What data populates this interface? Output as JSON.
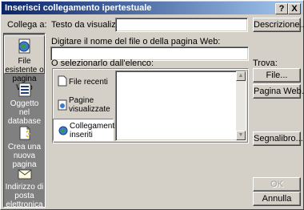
{
  "title": "Inserisci collegamento ipertestuale",
  "titlebar_buttons": {
    "help": "?",
    "close": "X"
  },
  "link_to": {
    "label": "Collega a:",
    "items": [
      {
        "label": "File esistente o pagina Web",
        "icon": "globe-page-icon",
        "selected": true
      },
      {
        "label": "Oggetto nel database",
        "icon": "database-object-icon",
        "selected": false
      },
      {
        "label": "Crea una nuova pagina",
        "icon": "new-page-icon",
        "selected": false
      },
      {
        "label": "Indirizzo di posta elettronica",
        "icon": "email-envelope-icon",
        "selected": false
      }
    ]
  },
  "text_to_display": {
    "label": "Testo da visualizzare:",
    "value": ""
  },
  "description_button": "Descrizione...",
  "url_field": {
    "label": "Digitare il nome del file o della pagina Web:",
    "value": ""
  },
  "select_list": {
    "label": "O selezionarlo dall'elenco:",
    "options": [
      {
        "label": "File recenti",
        "icon": "document-icon",
        "selected": false
      },
      {
        "label": "Pagine visualizzate",
        "icon": "browsed-page-icon",
        "selected": false
      },
      {
        "label": "Collegamenti inseriti",
        "icon": "inserted-links-icon",
        "selected": true
      }
    ]
  },
  "browse": {
    "label": "Trova:",
    "file_button": "File...",
    "web_page_button": "Pagina Web...",
    "bookmark_button": "Segnalibro..."
  },
  "ok_button": "OK",
  "cancel_button": "Annulla"
}
